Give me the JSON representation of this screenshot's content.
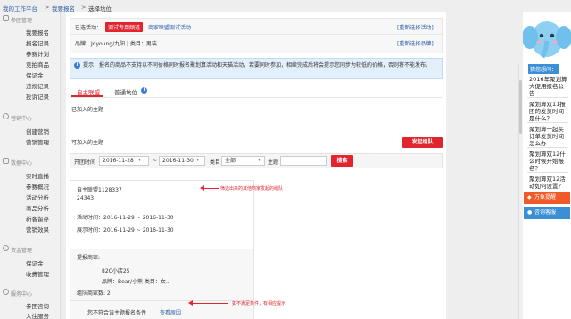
{
  "breadcrumb": {
    "items": [
      "我的工作平台",
      "我要报名",
      "选择坑位"
    ],
    "sep": ">"
  },
  "sidebar": {
    "sections": [
      {
        "title": "参团管理",
        "items": [
          "我要报名",
          "报名记录",
          "参赛计划",
          "竞拍商品",
          "保证金",
          "违规记录",
          "投诉记录"
        ]
      },
      {
        "title": "营销中心",
        "items": [
          "创建营销",
          "营销管理"
        ]
      },
      {
        "title": "数据中心",
        "items": [
          "实时直播",
          "参赛概况",
          "活动分析",
          "商品分析",
          "新客留存",
          "营销效果"
        ]
      },
      {
        "title": "资金管理",
        "items": [
          "保证金",
          "收费管理"
        ]
      },
      {
        "title": "服务中心",
        "items": [
          "参团咨询",
          "入住服务"
        ]
      }
    ]
  },
  "main": {
    "activity_label": "已选活动：",
    "activity_tag": "测试专用频道",
    "activity_name": "商家联盟测试活动",
    "reselect_activity": "[重新选择活动]",
    "brand_line": "品牌：Joyoung/九阳 | 类目：男装",
    "reselect_brand": "[重新选择品牌]",
    "notice": "提示：报名的商品不支持以不同价格同时报名聚划算活动和天猫活动，若要同时参加，相续完成后将会提示您同步为较低的价格，否则将不能发布。",
    "tabs": [
      "自主联盟",
      "普通坑位"
    ],
    "joined_label": "已加入的主题",
    "joinable_label": "可加入的主题",
    "create_team_btn": "发起组队",
    "filter": {
      "time_label": "开团时间",
      "start_date": "2016-11-28",
      "date_sep": "~",
      "end_date": "2016-11-30",
      "category_label": "类目",
      "category_value": "全部",
      "theme_label": "主题",
      "theme_placeholder": "",
      "search_btn": "搜索"
    },
    "card": {
      "title": "自主联盟1128337",
      "id": "24343",
      "activity_time": "活动时间：2016-11-29 ~ 2016-11-30",
      "display_time": "展示时间：2016-11-29 ~ 2016-11-30",
      "initiator_label": "提报商家:",
      "shop_name": "82C小店25",
      "brand_cat": "品牌：Bear/小熊    类目：女...",
      "count": "组队商家数: 2",
      "not_eligible": "您不符合该主题报名条件",
      "view_reason": "查看原因"
    },
    "annotations": {
      "a1": "筛选出来的其他商家发起的组队",
      "a2": "如不满足条件，有相应提示"
    }
  },
  "right_panel": {
    "header": "猜您想问：",
    "questions": [
      "2016年聚划算大促用报名公告",
      "聚划算双11报团的发货时间是什么？",
      "聚划算一起买订单发货时间怎么办",
      "聚划算双12什么时候开始报名？",
      "聚划算双12活动如何设置？"
    ],
    "btn_service": "万象提醒",
    "btn_feedback": "咨询客服"
  },
  "colors": {
    "accent_red": "#e0252f",
    "link_blue": "#2c5fa8",
    "notice_bg": "#e3f0fb",
    "panel_blue": "#3b8fd4"
  }
}
